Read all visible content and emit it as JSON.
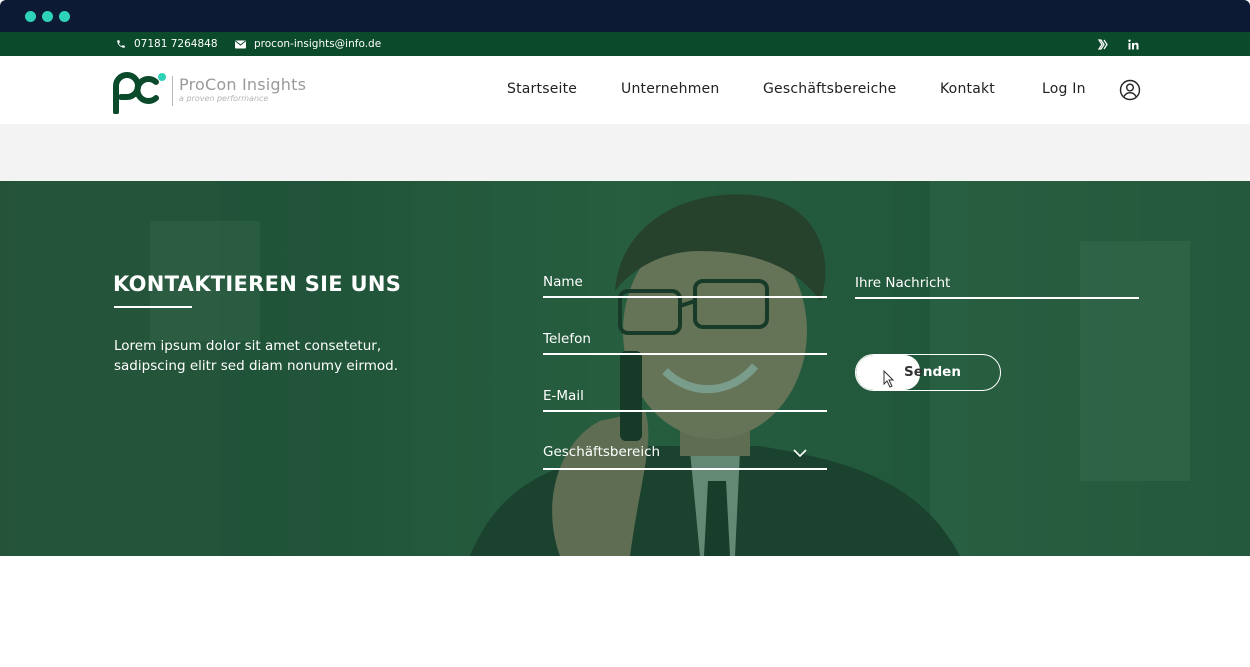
{
  "window": {
    "controls": [
      "dot",
      "dot",
      "dot"
    ]
  },
  "topbar": {
    "phone": "07181 7264848",
    "email": "procon-insights@info.de",
    "social": [
      "xing-icon",
      "linkedin-icon"
    ]
  },
  "brand": {
    "name": "ProCon Insights",
    "tagline": "a proven performance"
  },
  "nav": {
    "items": [
      "Startseite",
      "Unternehmen",
      "Geschäftsbereiche",
      "Kontakt",
      "Log In"
    ]
  },
  "contact": {
    "title": "KONTAKTIEREN SIE UNS",
    "description": "Lorem ipsum dolor sit amet consetetur, sadipscing elitr sed diam nonumy eirmod.",
    "fields": {
      "name": "Name",
      "phone": "Telefon",
      "email": "E-Mail",
      "message": "Ihre Nachricht"
    },
    "select": {
      "label": "Geschäftsbereich"
    },
    "send": {
      "label_dark": "Se",
      "label_light": "nden"
    }
  },
  "colors": {
    "brand_green": "#0b4a2b",
    "accent_dots": "#2ed3b7",
    "chrome": "#0d1a33"
  }
}
